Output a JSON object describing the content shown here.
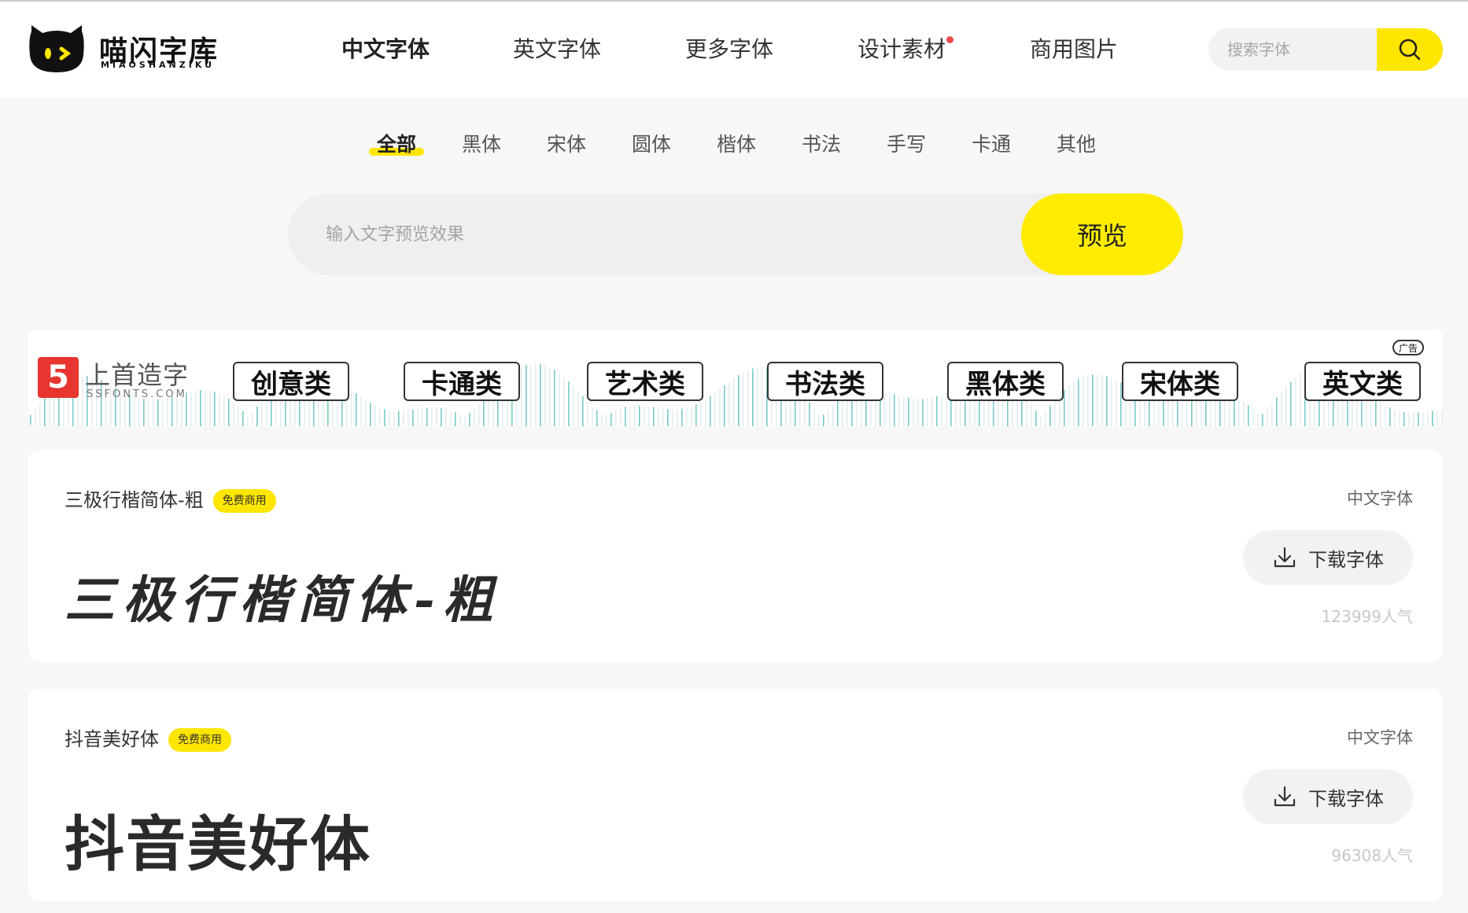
{
  "brand": {
    "name": "喵闪字库",
    "subtitle": "MIAOSHANZIKU"
  },
  "nav": {
    "items": [
      {
        "label": "中文字体",
        "active": true,
        "dot": false
      },
      {
        "label": "英文字体",
        "active": false,
        "dot": false
      },
      {
        "label": "更多字体",
        "active": false,
        "dot": false
      },
      {
        "label": "设计素材",
        "active": false,
        "dot": true
      },
      {
        "label": "商用图片",
        "active": false,
        "dot": false
      }
    ]
  },
  "search": {
    "placeholder": "搜索字体",
    "icon": "search-icon"
  },
  "categories": [
    {
      "label": "全部",
      "active": true
    },
    {
      "label": "黑体",
      "active": false
    },
    {
      "label": "宋体",
      "active": false
    },
    {
      "label": "圆体",
      "active": false
    },
    {
      "label": "楷体",
      "active": false
    },
    {
      "label": "书法",
      "active": false
    },
    {
      "label": "手写",
      "active": false
    },
    {
      "label": "卡通",
      "active": false
    },
    {
      "label": "其他",
      "active": false
    }
  ],
  "preview": {
    "placeholder": "输入文字预览效果",
    "button_label": "预览"
  },
  "banner": {
    "logo_mark": "5",
    "logo_name": "上首造字",
    "logo_url": "SSFONTS.COM",
    "ad_label": "广告",
    "tags": [
      "创意类",
      "卡通类",
      "艺术类",
      "书法类",
      "黑体类",
      "宋体类",
      "英文类"
    ]
  },
  "fonts": [
    {
      "name": "三极行楷简体-粗",
      "badge": "免费商用",
      "type": "中文字体",
      "sample": "三极行楷简体-粗",
      "download_label": "下载字体",
      "popularity": "123999人气"
    },
    {
      "name": "抖音美好体",
      "badge": "免费商用",
      "type": "中文字体",
      "sample": "抖音美好体",
      "download_label": "下载字体",
      "popularity": "96308人气"
    }
  ],
  "colors": {
    "accent": "#ffe600",
    "notify_dot": "#f04a4a",
    "banner_red": "#e8352f"
  }
}
